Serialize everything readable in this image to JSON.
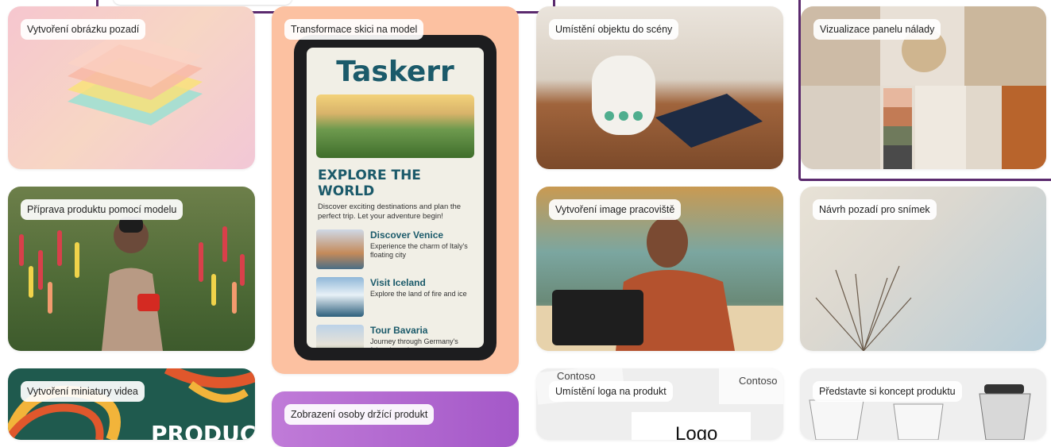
{
  "gallery": {
    "tiles": [
      {
        "label": "Vytvoření obrázku pozadí"
      },
      {
        "label": "Transformace skici na model"
      },
      {
        "label": "Umístění objektu do scény"
      },
      {
        "label": "Vizualizace panelu nálady"
      },
      {
        "label": "Příprava produktu pomocí modelu"
      },
      {
        "label": "Vytvoření image pracoviště"
      },
      {
        "label": "Návrh pozadí pro snímek"
      },
      {
        "label": "Vytvoření miniatury videa"
      },
      {
        "label": "Umístění loga na produkt"
      },
      {
        "label": "Představte si koncept produktu"
      },
      {
        "label": "Zobrazení osoby držící produkt"
      }
    ]
  },
  "mockup": {
    "app_title": "Taskerr",
    "headline": "EXPLORE THE WORLD",
    "subline": "Discover exciting destinations and plan the perfect trip. Let your adventure begin!",
    "destinations": [
      {
        "name": "Discover Venice",
        "desc": "Experience the charm of Italy's floating city"
      },
      {
        "name": "Visit Iceland",
        "desc": "Explore the land of fire and ice"
      },
      {
        "name": "Tour Bavaria",
        "desc": "Journey through Germany's fairytale region"
      }
    ]
  },
  "logo_tile": {
    "brand_text": "Contoso",
    "logo_text": "Logo"
  },
  "thumbnail_tile": {
    "big_text": "PRODUCT"
  },
  "colors": {
    "selection": "#5b2a6e",
    "mockup_accent": "#1b5a6a"
  }
}
